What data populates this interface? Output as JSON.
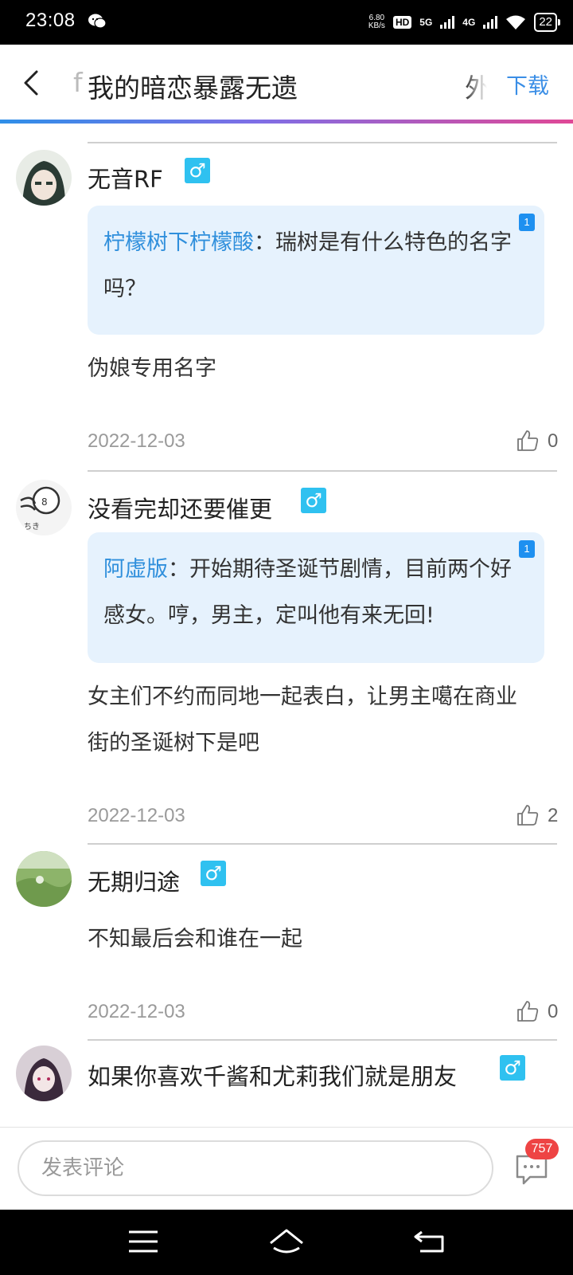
{
  "status_bar": {
    "time": "23:08",
    "net_speed_value": "6.80",
    "net_speed_unit": "KB/s",
    "hd_label": "HD",
    "hd_sub": "1 2",
    "net_5g": "5G",
    "net_4g": "4G",
    "battery": "22"
  },
  "header": {
    "title_fragment": "f",
    "title": "我的暗恋暴露无遗",
    "title_overflow": "外",
    "download_label": "下载"
  },
  "comments": [
    {
      "username": "无音RF",
      "gender_icon": "male-icon",
      "quote": {
        "author": "柠檬树下柠檬酸",
        "sep": "：",
        "text": "瑞树是有什么特色的名字吗？",
        "badge": "1"
      },
      "text": "伪娘专用名字",
      "date": "2022-12-03",
      "likes": "0"
    },
    {
      "username": "没看完却还要催更",
      "gender_icon": "male-icon",
      "quote": {
        "author": "阿虚版",
        "sep": "：",
        "text": "开始期待圣诞节剧情，目前两个好感女。哼，男主，定叫他有来无回!",
        "badge": "1"
      },
      "text": "女主们不约而同地一起表白，让男主噶在商业街的圣诞树下是吧",
      "date": "2022-12-03",
      "likes": "2"
    },
    {
      "username": "无期归途",
      "gender_icon": "male-icon",
      "text": "不知最后会和谁在一起",
      "date": "2022-12-03",
      "likes": "0"
    },
    {
      "username": "如果你喜欢千酱和尤莉我们就是朋友",
      "gender_icon": "male-icon"
    }
  ],
  "comment_bar": {
    "placeholder": "发表评论",
    "count_badge": "757"
  },
  "colors": {
    "accent": "#3a8ee6",
    "quote_bg": "#e6f2fd",
    "gender_badge": "#2fc1f0",
    "badge_red": "#ee4444"
  }
}
